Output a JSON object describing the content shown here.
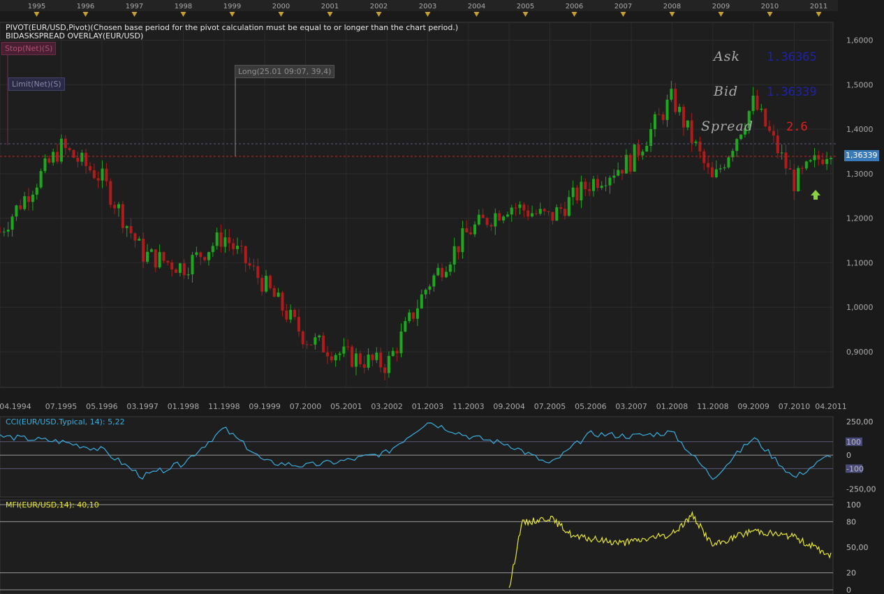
{
  "colors": {
    "background": "#1a1a1a",
    "plot_bg": "#1e1e1e",
    "grid": "#2c2c2c",
    "bull": "#1ea81e",
    "bear": "#b01c1c",
    "cci_line": "#3aaee0",
    "mfi_line": "#e8e830",
    "level_line": "#9a9a9a",
    "ask_bid_value": "#1f22a8",
    "spread_value": "#e02020",
    "price_tag": "#3a7ab8",
    "year_marker": "#c8a030"
  },
  "top_axis": {
    "years": [
      "1995",
      "1996",
      "1997",
      "1998",
      "1999",
      "2000",
      "2001",
      "2002",
      "2003",
      "2004",
      "2005",
      "2006",
      "2007",
      "2008",
      "2009",
      "2010",
      "2011"
    ]
  },
  "main_panel": {
    "indicator_line_1": "PIVOT(EUR/USD,Pivot)(Chosen base period for the pivot calculation must be equal to or longer than the chart period.)",
    "indicator_line_2": "BIDASKSPREAD OVERLAY(EUR/USD)",
    "stop_label": "Stop(Net)(S)",
    "limit_label": "Limit(Net)(S)",
    "long_label": "Long(25.01 09:07, 39,4)",
    "quote": {
      "ask_label": "Ask",
      "ask_value": "1.36365",
      "bid_label": "Bid",
      "bid_value": "1.36339",
      "spread_label": "Spread",
      "spread_value": "2.6"
    },
    "current_price_tag": "1,36339",
    "y_ticks": [
      "1,6000",
      "1,5000",
      "1,4000",
      "1,3000",
      "1,2000",
      "1,1000",
      "1,0000",
      "0,9000"
    ],
    "x_ticks": [
      "04.1994",
      "07.1995",
      "05.1996",
      "03.1997",
      "01.1998",
      "11.1998",
      "09.1999",
      "07.2000",
      "05.2001",
      "03.2002",
      "01.2003",
      "11.2003",
      "09.2004",
      "07.2005",
      "05.2006",
      "03.2007",
      "01.2008",
      "11.2008",
      "09.2009",
      "07.2010",
      "04.2011"
    ]
  },
  "cci_panel": {
    "title": "CCI(EUR/USD.Typical, 14): 5,22",
    "y_ticks": [
      "250,00",
      "100",
      "0",
      "-100",
      "-250,00"
    ]
  },
  "mfi_panel": {
    "title": "MFI(EUR/USD,14): 40,10",
    "y_ticks": [
      "100",
      "80",
      "50,00",
      "20",
      "0"
    ]
  },
  "chart_data": [
    {
      "type": "candlestick",
      "title": "",
      "ylim": [
        0.82,
        1.64
      ],
      "series": [
        {
          "name": "EUR/USD",
          "x": [
            "04.1994",
            "07.1995",
            "05.1996",
            "03.1997",
            "01.1998",
            "11.1998",
            "09.1999",
            "07.2000",
            "05.2001",
            "03.2002",
            "01.2003",
            "11.2003",
            "09.2004",
            "07.2005",
            "05.2006",
            "03.2007",
            "01.2008",
            "11.2008",
            "09.2009",
            "07.2010",
            "04.2011"
          ],
          "values": [
            1.17,
            1.36,
            1.29,
            1.12,
            1.09,
            1.16,
            1.05,
            0.93,
            0.89,
            0.87,
            1.05,
            1.17,
            1.23,
            1.2,
            1.28,
            1.33,
            1.47,
            1.28,
            1.46,
            1.28,
            1.36
          ]
        }
      ]
    },
    {
      "type": "line",
      "title": "",
      "ylim": [
        -300,
        270
      ],
      "series": [
        {
          "name": "CCI",
          "x": [
            "04.1994",
            "07.1995",
            "05.1996",
            "03.1997",
            "01.1998",
            "11.1998",
            "09.1999",
            "07.2000",
            "05.2001",
            "03.2002",
            "01.2003",
            "11.2003",
            "09.2004",
            "07.2005",
            "05.2006",
            "03.2007",
            "01.2008",
            "11.2008",
            "09.2009",
            "07.2010",
            "04.2011"
          ],
          "values": [
            140,
            100,
            40,
            -160,
            -60,
            200,
            -50,
            -80,
            -40,
            20,
            250,
            140,
            80,
            -70,
            160,
            140,
            170,
            -170,
            130,
            -170,
            5
          ]
        }
      ]
    },
    {
      "type": "line",
      "title": "",
      "ylim": [
        0,
        100
      ],
      "series": [
        {
          "name": "MFI",
          "x": [
            "09.2004",
            "12.2004",
            "07.2005",
            "01.2006",
            "01.2007",
            "01.2008",
            "06.2008",
            "11.2008",
            "09.2009",
            "07.2010",
            "04.2011"
          ],
          "values": [
            0,
            78,
            85,
            62,
            55,
            65,
            88,
            52,
            70,
            62,
            40
          ]
        }
      ]
    }
  ]
}
